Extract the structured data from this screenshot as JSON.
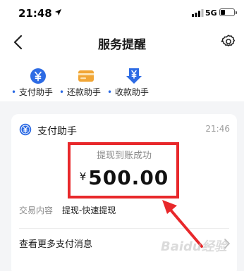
{
  "colors": {
    "accent": "#2d6be4",
    "income": "#f1a636",
    "highlight": "#e8282b",
    "background": "#f4f5f7"
  },
  "status_bar": {
    "time": "21:48",
    "network": "5G"
  },
  "nav": {
    "title": "服务提醒",
    "back_icon": "chevron-left-icon",
    "settings_icon": "gear-icon"
  },
  "shortcuts": [
    {
      "label": "支付助手",
      "icon": "yuan-coin-icon",
      "color": "#2d6be4"
    },
    {
      "label": "还款助手",
      "icon": "card-icon",
      "color": "#f1a636"
    },
    {
      "label": "收款助手",
      "icon": "download-yuan-icon",
      "color": "#2d6be4"
    }
  ],
  "card": {
    "title": "支付助手",
    "time": "21:46",
    "status": "提现到账成功",
    "currency": "¥",
    "amount": "500.00",
    "detail_label": "交易内容",
    "detail_value": "提现-快速提现",
    "more_label": "查看更多支付消息"
  },
  "watermark": "Baidu经验"
}
